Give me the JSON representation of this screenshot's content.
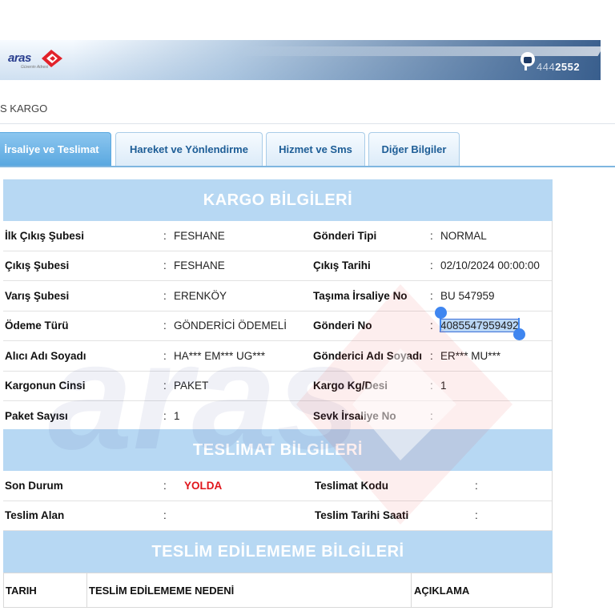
{
  "header": {
    "logo_text": "aras",
    "logo_tagline": "Güvenin Adresi",
    "phone_prefix": "444",
    "phone_suffix": "2552"
  },
  "breadcrumb": "S KARGO",
  "tabs": [
    {
      "label": "İrsaliye ve Teslimat",
      "active": true
    },
    {
      "label": "Hareket ve Yönlendirme",
      "active": false
    },
    {
      "label": "Hizmet ve Sms",
      "active": false
    },
    {
      "label": "Diğer Bilgiler",
      "active": false
    }
  ],
  "kargo": {
    "title": "KARGO BİLGİLERİ",
    "rows": [
      {
        "l1": "İlk Çıkış Şubesi",
        "v1": "FESHANE",
        "l2": "Gönderi Tipi",
        "v2": "NORMAL"
      },
      {
        "l1": "Çıkış Şubesi",
        "v1": "FESHANE",
        "l2": "Çıkış Tarihi",
        "v2": "02/10/2024 00:00:00"
      },
      {
        "l1": "Varış Şubesi",
        "v1": "ERENKÖY",
        "l2": "Taşıma İrsaliye No",
        "v2": "BU 547959"
      },
      {
        "l1": "Ödeme Türü",
        "v1": "GÖNDERİCİ ÖDEMELİ",
        "l2": "Gönderi No",
        "v2": "4085547959492"
      },
      {
        "l1": "Alıcı Adı Soyadı",
        "v1": "HA*** EM*** UG***",
        "l2": "Gönderici Adı Soyadı",
        "v2": "ER*** MU***"
      },
      {
        "l1": "Kargonun Cinsi",
        "v1": "PAKET",
        "l2": "Kargo Kg/Desi",
        "v2": "1"
      },
      {
        "l1": "Paket Sayısı",
        "v1": "1",
        "l2": "Sevk İrsaliye No",
        "v2": ""
      }
    ]
  },
  "teslimat": {
    "title": "TESLİMAT BİLGİLERİ",
    "son_durum_label": "Son Durum",
    "son_durum_value": "YOLDA",
    "teslimat_kodu_label": "Teslimat Kodu",
    "teslim_alan_label": "Teslim Alan",
    "teslim_tarihi_label": "Teslim Tarihi Saati"
  },
  "teslim_edilememe": {
    "title": "TESLİM EDİLEMEME BİLGİLERİ",
    "columns": [
      "TARIH",
      "TESLİM EDİLEMEME NEDENİ",
      "AÇIKLAMA"
    ]
  },
  "colors": {
    "accent": "#5aa8e0",
    "section_header": "#b7d8f3",
    "status_red": "#e0151b",
    "brand_red": "#e2222a",
    "brand_blue": "#2a3f8f"
  },
  "sep": ":"
}
